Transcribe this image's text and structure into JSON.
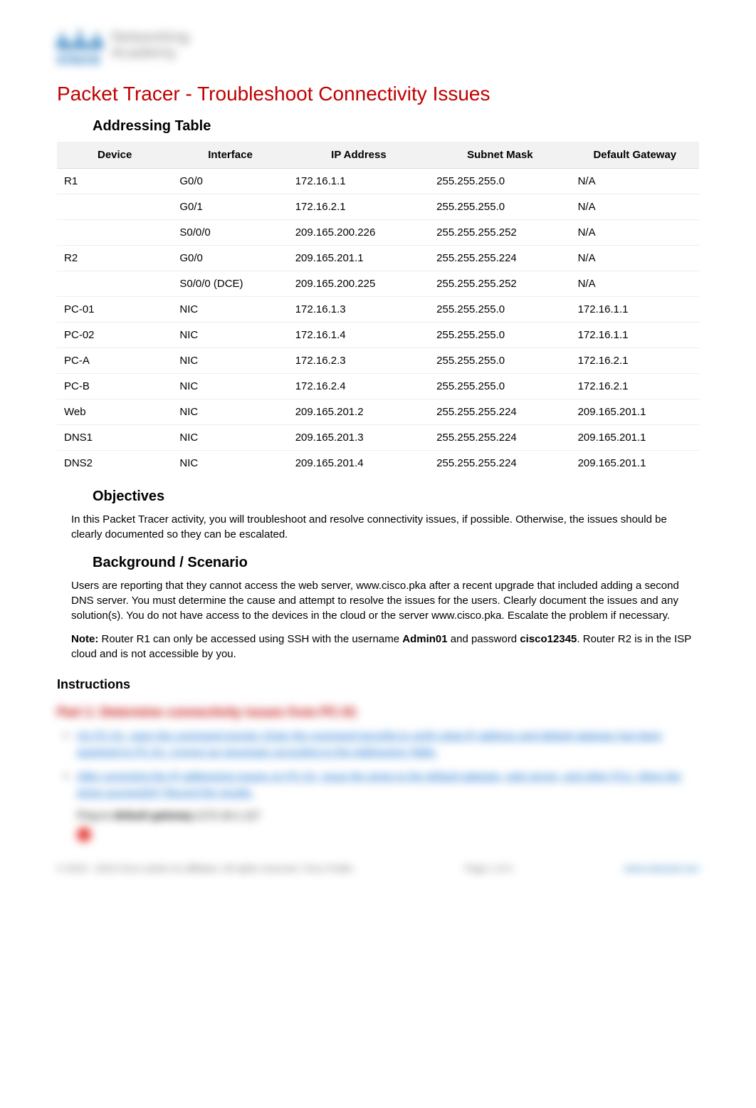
{
  "logo": {
    "brand_top": "Networking",
    "brand_bottom": "Academy",
    "brand_name": "cisco"
  },
  "title": "Packet Tracer - Troubleshoot Connectivity Issues",
  "addressing_heading": "Addressing Table",
  "table": {
    "headers": [
      "Device",
      "Interface",
      "IP Address",
      "Subnet Mask",
      "Default Gateway"
    ],
    "rows": [
      {
        "device": "R1",
        "interface": "G0/0",
        "ip": "172.16.1.1",
        "mask": "255.255.255.0",
        "gw": "N/A"
      },
      {
        "device": "",
        "interface": "G0/1",
        "ip": "172.16.2.1",
        "mask": "255.255.255.0",
        "gw": "N/A"
      },
      {
        "device": "",
        "interface": "S0/0/0",
        "ip": "209.165.200.226",
        "mask": "255.255.255.252",
        "gw": "N/A"
      },
      {
        "device": "R2",
        "interface": "G0/0",
        "ip": "209.165.201.1",
        "mask": "255.255.255.224",
        "gw": "N/A"
      },
      {
        "device": "",
        "interface": "S0/0/0 (DCE)",
        "ip": "209.165.200.225",
        "mask": "255.255.255.252",
        "gw": "N/A"
      },
      {
        "device": "PC-01",
        "interface": "NIC",
        "ip": "172.16.1.3",
        "mask": "255.255.255.0",
        "gw": "172.16.1.1"
      },
      {
        "device": "PC-02",
        "interface": "NIC",
        "ip": "172.16.1.4",
        "mask": "255.255.255.0",
        "gw": "172.16.1.1"
      },
      {
        "device": "PC-A",
        "interface": "NIC",
        "ip": "172.16.2.3",
        "mask": "255.255.255.0",
        "gw": "172.16.2.1"
      },
      {
        "device": "PC-B",
        "interface": "NIC",
        "ip": "172.16.2.4",
        "mask": "255.255.255.0",
        "gw": "172.16.2.1"
      },
      {
        "device": "Web",
        "interface": "NIC",
        "ip": "209.165.201.2",
        "mask": "255.255.255.224",
        "gw": "209.165.201.1"
      },
      {
        "device": "DNS1",
        "interface": "NIC",
        "ip": "209.165.201.3",
        "mask": "255.255.255.224",
        "gw": "209.165.201.1"
      },
      {
        "device": "DNS2",
        "interface": "NIC",
        "ip": "209.165.201.4",
        "mask": "255.255.255.224",
        "gw": "209.165.201.1"
      }
    ]
  },
  "objectives": {
    "heading": "Objectives",
    "text": "In this Packet Tracer activity, you will troubleshoot and resolve connectivity issues, if possible. Otherwise, the issues should be clearly documented so they can be escalated."
  },
  "background": {
    "heading": "Background / Scenario",
    "text": "Users are reporting that they cannot access the web server, www.cisco.pka after a recent upgrade that included adding a second DNS server. You must determine the cause and attempt to resolve the issues for the users. Clearly document the issues and any solution(s). You do not have access to the devices in the cloud or the server www.cisco.pka. Escalate the problem if necessary.",
    "note_label": "Note:",
    "note_text_a": " Router R1 can only be accessed using SSH with the username ",
    "note_user": "Admin01",
    "note_text_b": " and password ",
    "note_pass": "cisco12345",
    "note_text_c": ". Router R2 is in the ISP cloud and is not accessible by you."
  },
  "instructions": {
    "heading": "Instructions",
    "part_heading": "Part 1: Determine connectivity issues from PC-01",
    "bullets": [
      "On PC-01, open the command prompt. Enter the command ipconfig to verify what IP address and default gateway has been assigned to PC-01. Correct as necessary according to the Addressing Table.",
      "After correcting the IP addressing issues on PC-01, issue the pings to the default gateway, web server, and other PCs. Were the pings successful? Record the results."
    ],
    "ping_line_a": "Ping to ",
    "ping_line_b": "default gateway",
    "ping_line_c": " (172.16.1.1)?",
    "footer_left": "© 2019 - 2019 Cisco and/or its affiliates. All rights reserved. Cisco Public",
    "footer_mid": "Page 1 of 4",
    "footer_right": "www.netacad.com"
  }
}
